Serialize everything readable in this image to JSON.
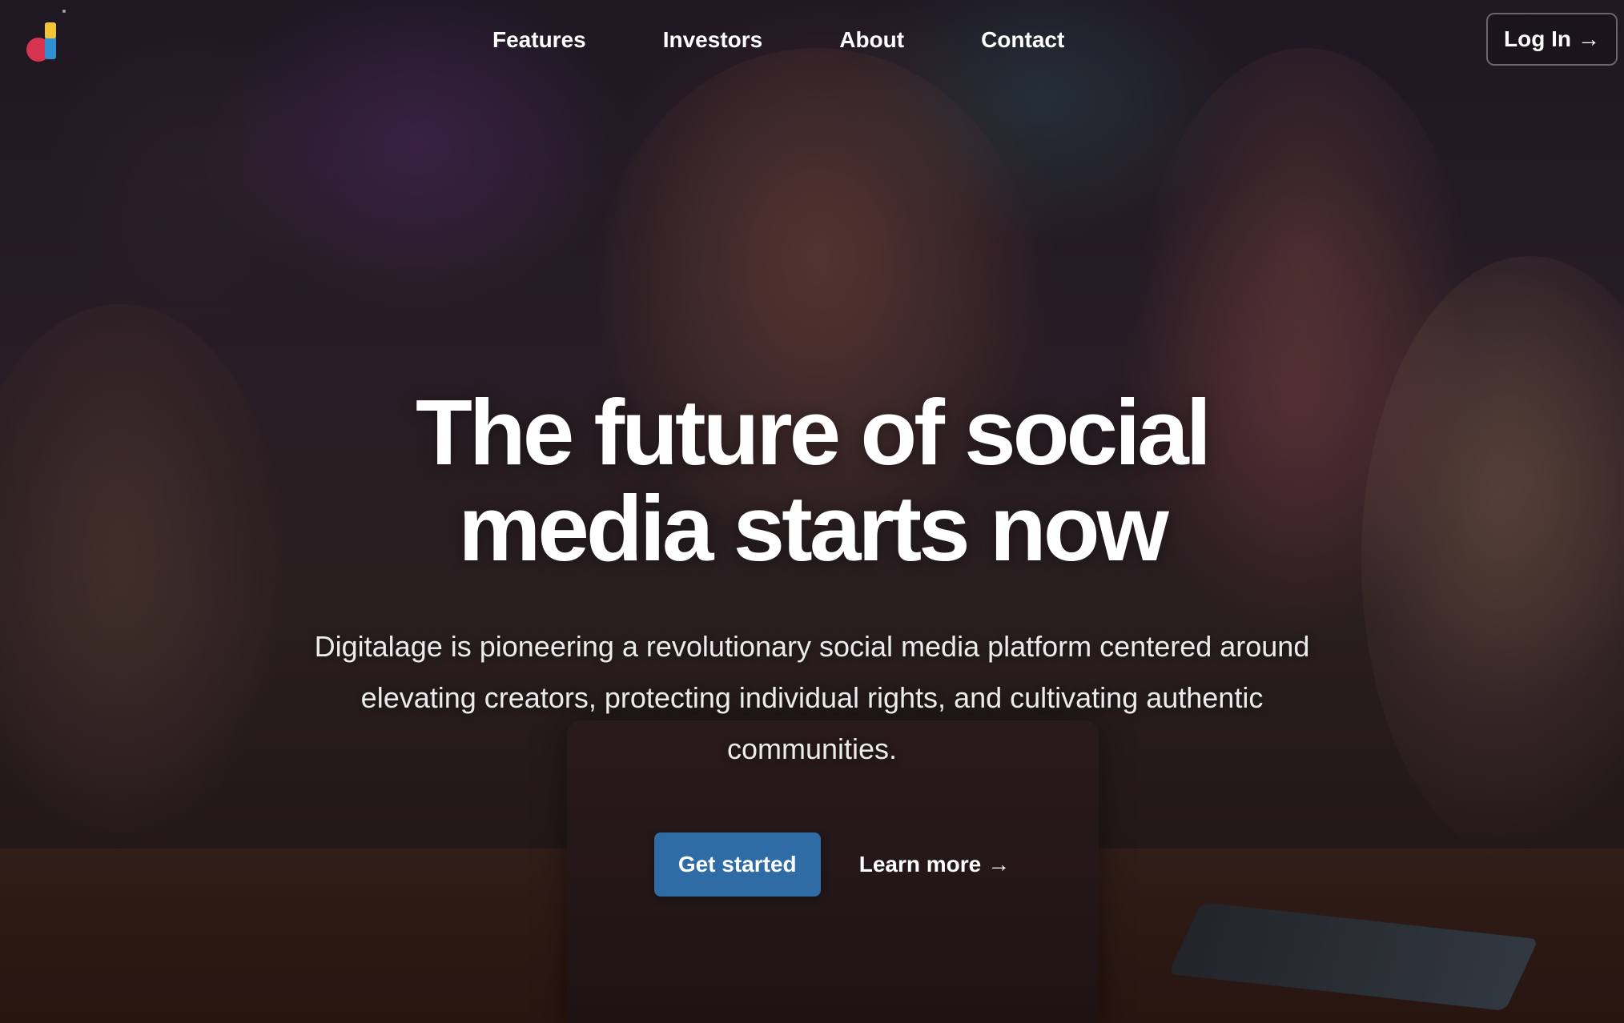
{
  "nav": {
    "logo_icon": "digitalage-logo-icon",
    "links": [
      {
        "label": "Features"
      },
      {
        "label": "Investors"
      },
      {
        "label": "About"
      },
      {
        "label": "Contact"
      }
    ],
    "login_label": "Log In",
    "arrow_glyph": "→"
  },
  "hero": {
    "title_line1": "The future of social",
    "title_line2": "media starts now",
    "subtitle": "Digitalage is pioneering a revolutionary social media platform centered around elevating creators, protecting individual rights, and cultivating authentic communities.",
    "primary_cta": "Get started",
    "secondary_cta": "Learn more",
    "arrow_glyph": "→"
  },
  "colors": {
    "primary_button": "#2f6ba5",
    "logo_red": "#d8344f",
    "logo_yellow": "#f2c43a",
    "logo_blue": "#2f8fd0"
  }
}
